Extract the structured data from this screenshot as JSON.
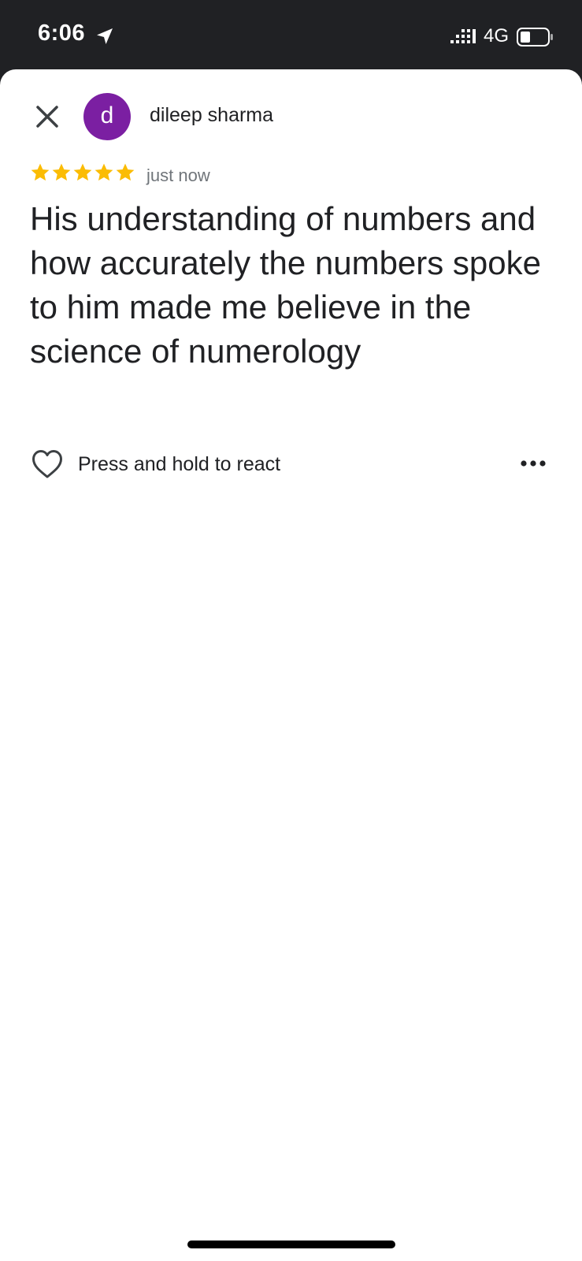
{
  "status_bar": {
    "time": "6:06",
    "network": "4G",
    "icons": [
      "location-arrow-icon",
      "signal-icon",
      "battery-icon"
    ]
  },
  "review": {
    "reviewer_name": "dileep sharma",
    "avatar_letter": "d",
    "avatar_color": "#7b1fa2",
    "rating": 5,
    "rating_max": 5,
    "star_color": "#fbbc04",
    "timestamp": "just now",
    "text": "His understanding of numbers and how accurately the numbers spoke to him made me believe in the science of numerology"
  },
  "actions": {
    "react_label": "Press and hold to react",
    "icons": [
      "close-icon",
      "heart-icon",
      "more-options-icon"
    ]
  }
}
